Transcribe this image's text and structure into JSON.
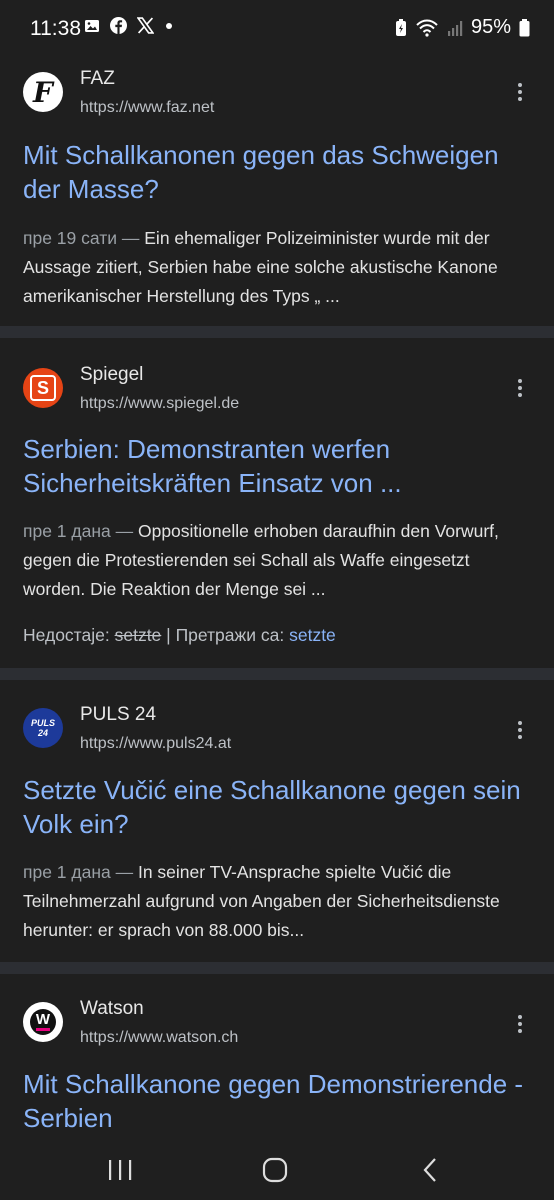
{
  "status_bar": {
    "time": "11:38",
    "battery": "95%",
    "notification_icons": [
      "image-icon",
      "facebook-icon",
      "x-icon",
      "dot-icon"
    ],
    "system_icons": [
      "battery-saver-icon",
      "wifi-icon",
      "signal-icon",
      "battery-icon"
    ]
  },
  "results": [
    {
      "source": "FAZ",
      "url": "https://www.faz.net",
      "logo_text": "F",
      "title": "Mit Schallkanonen gegen das Schweigen der Masse?",
      "date": "пре 19 сати —",
      "snippet": " Ein ehemaliger Polizeiminister wurde mit der Aussage zitiert, Serbien habe eine solche akustische Kanone amerikanischer Herstellung des Typs „ ..."
    },
    {
      "source": "Spiegel",
      "url": "https://www.spiegel.de",
      "logo_text": "S",
      "title": "Serbien: Demonstranten werfen Sicherheitskräften Einsatz von ...",
      "date": "пре 1 дана —",
      "snippet": " Oppositionelle erhoben daraufhin den Vorwurf, gegen die Protestierenden sei Schall als Waffe eingesetzt worden. Die Reaktion der Menge sei ...",
      "missing_label": "Недостаје:",
      "missing_word": "setzte",
      "search_with_label": "| Претражи са:",
      "search_with_word": "setzte"
    },
    {
      "source": "PULS 24",
      "url": "https://www.puls24.at",
      "logo_text": "PULS 24",
      "title": "Setzte Vučić eine Schallkanone gegen sein Volk ein?",
      "date": "пре 1 дана —",
      "snippet": " In seiner TV-Ansprache spielte Vučić die Teilnehmerzahl aufgrund von Angaben der Sicherheitsdienste herunter: er sprach von 88.000 bis..."
    },
    {
      "source": "Watson",
      "url": "https://www.watson.ch",
      "logo_text": "W",
      "title": "Mit Schallkanone gegen Demonstrierende - Serbien"
    }
  ],
  "nav": {
    "icons": [
      "recent-apps-icon",
      "home-icon",
      "back-icon"
    ]
  },
  "colors": {
    "background": "#1f1f1f",
    "link": "#8ab4f8",
    "separator": "#2c2e33",
    "spiegel_orange": "#e64415",
    "puls_blue": "#1d3a9a",
    "watson_pink": "#e6007e"
  }
}
